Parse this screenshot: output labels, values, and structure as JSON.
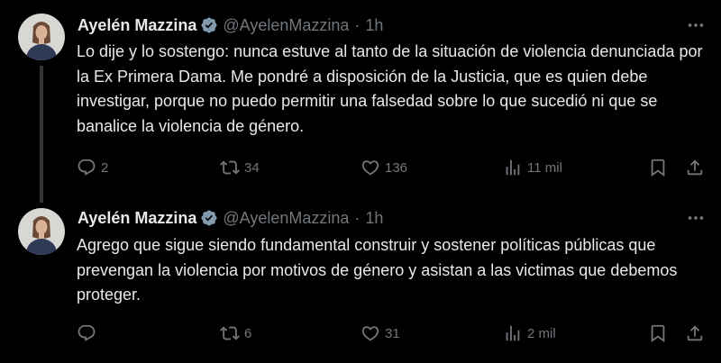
{
  "tweets": [
    {
      "author_name": "Ayelén Mazzina",
      "handle": "@AyelenMazzina",
      "separator": "·",
      "time": "1h",
      "paragraphs": [
        "Lo dije y lo sostengo: nunca estuve al tanto de la situación de violencia denunciada por la Ex Primera Dama. Me pondré a disposición de la Justicia, que es quien debe investigar, porque no puedo permitir una falsedad sobre lo que sucedió ni que se banalice la violencia de género."
      ],
      "replies": "2",
      "retweets": "34",
      "likes": "136",
      "views": "11 mil"
    },
    {
      "author_name": "Ayelén Mazzina",
      "handle": "@AyelenMazzina",
      "separator": "·",
      "time": "1h",
      "paragraphs": [
        "Agrego que sigue siendo fundamental construir y sostener políticas públicas que prevengan la violencia por motivos de género y asistan a las victimas que debemos proteger."
      ],
      "replies": "",
      "retweets": "6",
      "likes": "31",
      "views": "2 mil"
    }
  ],
  "icons": {
    "verified": "verified-badge-icon",
    "more": "more-options-icon",
    "reply": "reply-icon",
    "retweet": "retweet-icon",
    "like": "like-icon",
    "views": "views-icon",
    "bookmark": "bookmark-icon",
    "share": "share-icon"
  },
  "colors": {
    "background": "#000000",
    "text": "#e7e9ea",
    "muted": "#71767b",
    "verified_badge": "#829aab",
    "thread_line": "#333639"
  }
}
